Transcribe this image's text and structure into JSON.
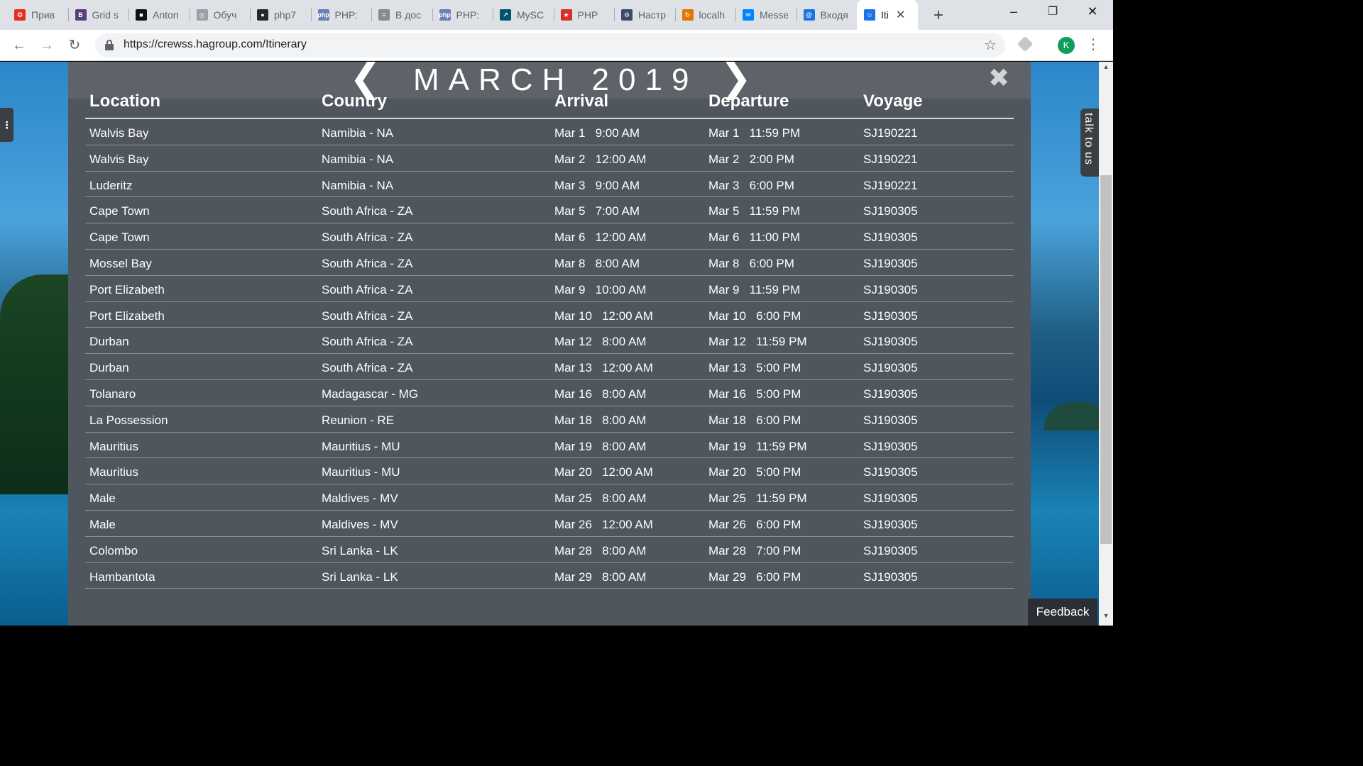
{
  "browser": {
    "tabs": [
      {
        "label": "Прив",
        "icon": "figure-icon",
        "color": "#e0301e",
        "glyph": "❂"
      },
      {
        "label": "Grid s",
        "icon": "bootstrap-icon",
        "color": "#563d7c",
        "glyph": "B"
      },
      {
        "label": "Anton",
        "icon": "dark-square-icon",
        "color": "#111111",
        "glyph": "■"
      },
      {
        "label": "Обуч",
        "icon": "brain-icon",
        "color": "#9aa0a6",
        "glyph": "◎"
      },
      {
        "label": "php7",
        "icon": "github-icon",
        "color": "#24292e",
        "glyph": "●"
      },
      {
        "label": "PHP:",
        "icon": "php-icon",
        "color": "#6c7eb7",
        "glyph": "php"
      },
      {
        "label": "В дос",
        "icon": "book-icon",
        "color": "#8a8a8a",
        "glyph": "≡"
      },
      {
        "label": "PHP:",
        "icon": "php-icon",
        "color": "#6c7eb7",
        "glyph": "php"
      },
      {
        "label": "MySC",
        "icon": "mysql-icon",
        "color": "#00546b",
        "glyph": "↗"
      },
      {
        "label": "PHP",
        "icon": "elephant-icon",
        "color": "#d93025",
        "glyph": "★"
      },
      {
        "label": "Настр",
        "icon": "settings-icon",
        "color": "#3c4a6b",
        "glyph": "⚙"
      },
      {
        "label": "localh",
        "icon": "swirl-icon",
        "color": "#e37400",
        "glyph": "↻"
      },
      {
        "label": "Messe",
        "icon": "messenger-icon",
        "color": "#0084ff",
        "glyph": "✉"
      },
      {
        "label": "Входя",
        "icon": "mail-icon",
        "color": "#1a73e8",
        "glyph": "@"
      },
      {
        "label": "Iti",
        "icon": "person-icon",
        "color": "#1a73e8",
        "glyph": "☺",
        "active": true
      }
    ],
    "url": "https://crewss.hagroup.com/Itinerary",
    "profile_initial": "K"
  },
  "itinerary": {
    "month_title": "MARCH 2019",
    "columns": [
      "Location",
      "Country",
      "Arrival",
      "Departure",
      "Voyage"
    ],
    "rows": [
      [
        "Walvis Bay",
        "Namibia - NA",
        "Mar 1   9:00 AM",
        "Mar 1   11:59 PM",
        "SJ190221"
      ],
      [
        "Walvis Bay",
        "Namibia - NA",
        "Mar 2   12:00 AM",
        "Mar 2   2:00 PM",
        "SJ190221"
      ],
      [
        "Luderitz",
        "Namibia - NA",
        "Mar 3   9:00 AM",
        "Mar 3   6:00 PM",
        "SJ190221"
      ],
      [
        "Cape Town",
        "South Africa - ZA",
        "Mar 5   7:00 AM",
        "Mar 5   11:59 PM",
        "SJ190305"
      ],
      [
        "Cape Town",
        "South Africa - ZA",
        "Mar 6   12:00 AM",
        "Mar 6   11:00 PM",
        "SJ190305"
      ],
      [
        "Mossel Bay",
        "South Africa - ZA",
        "Mar 8   8:00 AM",
        "Mar 8   6:00 PM",
        "SJ190305"
      ],
      [
        "Port Elizabeth",
        "South Africa - ZA",
        "Mar 9   10:00 AM",
        "Mar 9   11:59 PM",
        "SJ190305"
      ],
      [
        "Port Elizabeth",
        "South Africa - ZA",
        "Mar 10   12:00 AM",
        "Mar 10   6:00 PM",
        "SJ190305"
      ],
      [
        "Durban",
        "South Africa - ZA",
        "Mar 12   8:00 AM",
        "Mar 12   11:59 PM",
        "SJ190305"
      ],
      [
        "Durban",
        "South Africa - ZA",
        "Mar 13   12:00 AM",
        "Mar 13   5:00 PM",
        "SJ190305"
      ],
      [
        "Tolanaro",
        "Madagascar - MG",
        "Mar 16   8:00 AM",
        "Mar 16   5:00 PM",
        "SJ190305"
      ],
      [
        "La Possession",
        "Reunion - RE",
        "Mar 18   8:00 AM",
        "Mar 18   6:00 PM",
        "SJ190305"
      ],
      [
        "Mauritius",
        "Mauritius - MU",
        "Mar 19   8:00 AM",
        "Mar 19   11:59 PM",
        "SJ190305"
      ],
      [
        "Mauritius",
        "Mauritius - MU",
        "Mar 20   12:00 AM",
        "Mar 20   5:00 PM",
        "SJ190305"
      ],
      [
        "Male",
        "Maldives - MV",
        "Mar 25   8:00 AM",
        "Mar 25   11:59 PM",
        "SJ190305"
      ],
      [
        "Male",
        "Maldives - MV",
        "Mar 26   12:00 AM",
        "Mar 26   6:00 PM",
        "SJ190305"
      ],
      [
        "Colombo",
        "Sri Lanka - LK",
        "Mar 28   8:00 AM",
        "Mar 28   7:00 PM",
        "SJ190305"
      ],
      [
        "Hambantota",
        "Sri Lanka - LK",
        "Mar 29   8:00 AM",
        "Mar 29   6:00 PM",
        "SJ190305"
      ]
    ]
  },
  "side_tab": {
    "label": "talk to us"
  },
  "feedback": {
    "label": "Feedback"
  },
  "colors": {
    "panel": "#4f565d",
    "header_bar": "#5e6369",
    "text": "#ffffff"
  }
}
